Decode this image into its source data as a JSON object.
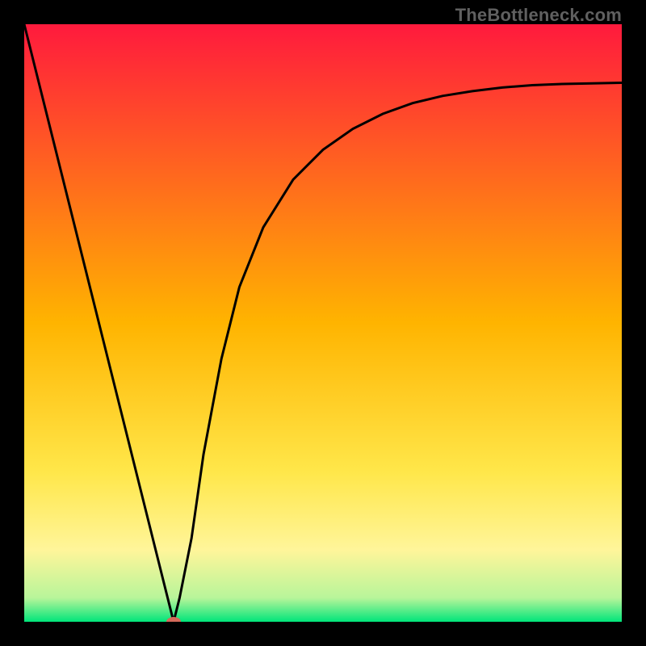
{
  "watermark": "TheBottleneck.com",
  "chart_data": {
    "type": "line",
    "title": "",
    "xlabel": "",
    "ylabel": "",
    "xlim": [
      0,
      100
    ],
    "ylim": [
      0,
      100
    ],
    "grid": false,
    "legend": "none",
    "gradient_stops": [
      {
        "offset": 0.0,
        "color": "#ff1a3d"
      },
      {
        "offset": 0.5,
        "color": "#ffb400"
      },
      {
        "offset": 0.75,
        "color": "#ffe74a"
      },
      {
        "offset": 0.88,
        "color": "#fff59a"
      },
      {
        "offset": 0.96,
        "color": "#b8f59a"
      },
      {
        "offset": 1.0,
        "color": "#00e57a"
      }
    ],
    "series": [
      {
        "name": "bottleneck-curve",
        "x": [
          0,
          5,
          10,
          15,
          20,
          22,
          24,
          25,
          26,
          28,
          30,
          33,
          36,
          40,
          45,
          50,
          55,
          60,
          65,
          70,
          75,
          80,
          85,
          90,
          95,
          100
        ],
        "y": [
          100,
          80,
          60,
          40,
          20,
          12,
          4,
          0,
          4,
          14,
          28,
          44,
          56,
          66,
          74,
          79,
          82.5,
          85,
          86.8,
          88,
          88.8,
          89.4,
          89.8,
          90,
          90.1,
          90.2
        ]
      }
    ],
    "markers": [
      {
        "name": "sweet-spot",
        "x": 25,
        "y": 0,
        "color": "#d46a5a",
        "rx": 9,
        "ry": 6
      }
    ]
  }
}
